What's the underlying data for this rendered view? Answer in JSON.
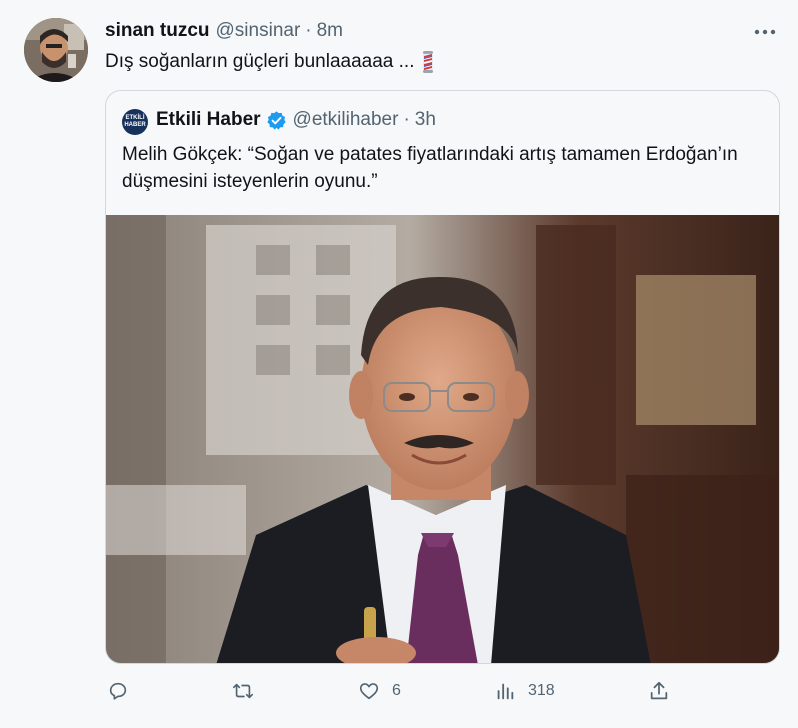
{
  "tweet": {
    "author_name": "sinan tuzcu",
    "author_handle": "@sinsinar",
    "separator": "·",
    "time": "8m",
    "text": "Dış soğanların güçleri bunlaaaaaa ...",
    "emoji": "barber-pole",
    "avatar": "user-avatar"
  },
  "quote": {
    "avatar_line1": "ETKİLİ",
    "avatar_line2": "HABER",
    "author_name": "Etkili Haber",
    "verified": "verified-badge",
    "author_handle": "@etkilihaber",
    "separator": "·",
    "time": "3h",
    "text": "Melih Gökçek: “Soğan ve patates fiyatlarındaki artış tamamen Erdoğan’ın düşmesini isteyenlerin oyunu.”",
    "photo": "portrait-photo"
  },
  "actions": {
    "reply": {
      "icon": "reply-icon",
      "count": ""
    },
    "retweet": {
      "icon": "retweet-icon",
      "count": ""
    },
    "like": {
      "icon": "heart-icon",
      "count": "6"
    },
    "views": {
      "icon": "views-icon",
      "count": "318"
    },
    "share": {
      "icon": "share-icon",
      "count": ""
    }
  },
  "colors": {
    "background": "#f7f8f9",
    "text": "#0f1419",
    "muted": "#536471",
    "border": "#cfd9de",
    "verified_blue": "#1d9bf0"
  }
}
